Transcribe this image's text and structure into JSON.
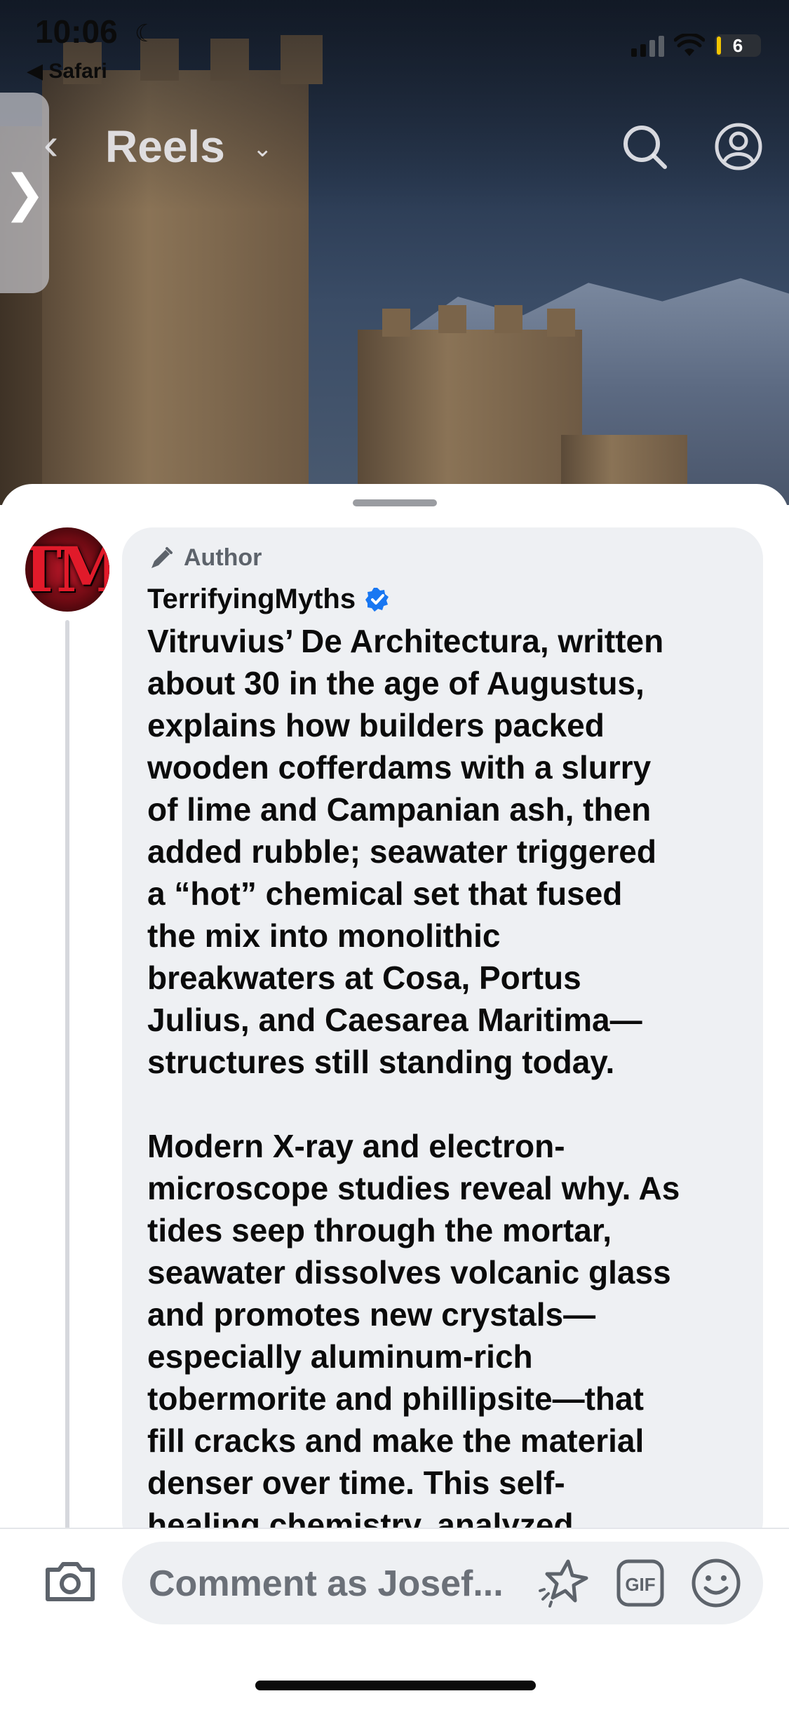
{
  "status_bar": {
    "time": "10:06",
    "back_app": "◀ Safari",
    "battery": "6"
  },
  "header": {
    "title": "Reels"
  },
  "comment": {
    "author_label": "Author",
    "username": "TerrifyingMyths",
    "verified": true,
    "text": "Vitruvius’ De Architectura, written\nabout 30 in the age of Augustus,\nexplains how builders packed\nwooden cofferdams with a slurry\nof lime and Campanian ash, then\nadded rubble; seawater triggered\na “hot” chemical set that fused\nthe mix into monolithic\nbreakwaters at Cosa, Portus\nJulius, and Caesarea Maritima—\nstructures still standing today.\n\nModern X-ray and electron-\nmicroscope studies reveal why. As\ntides seep through the mortar,\nseawater dissolves volcanic glass\nand promotes new crystals—\nespecially aluminum-rich\ntobermorite and phillipsite—that\nfill cracks and make the material\ndenser over time. This self-\nhealing chemistry, analyzed"
  },
  "composer": {
    "placeholder": "Comment as Josef..."
  },
  "colors": {
    "accent_blue": "#1877f2",
    "sheet_bg": "#ffffff",
    "bubble_bg": "#eef0f3"
  },
  "icons": [
    "moon-icon",
    "signal-icon",
    "wifi-icon",
    "battery-icon",
    "chevron-right-icon",
    "back-arrow-icon",
    "chevron-down-icon",
    "search-icon",
    "profile-icon",
    "pencil-icon",
    "verified-badge-icon",
    "camera-icon",
    "sparkle-icon",
    "gif-icon",
    "emoji-icon"
  ]
}
